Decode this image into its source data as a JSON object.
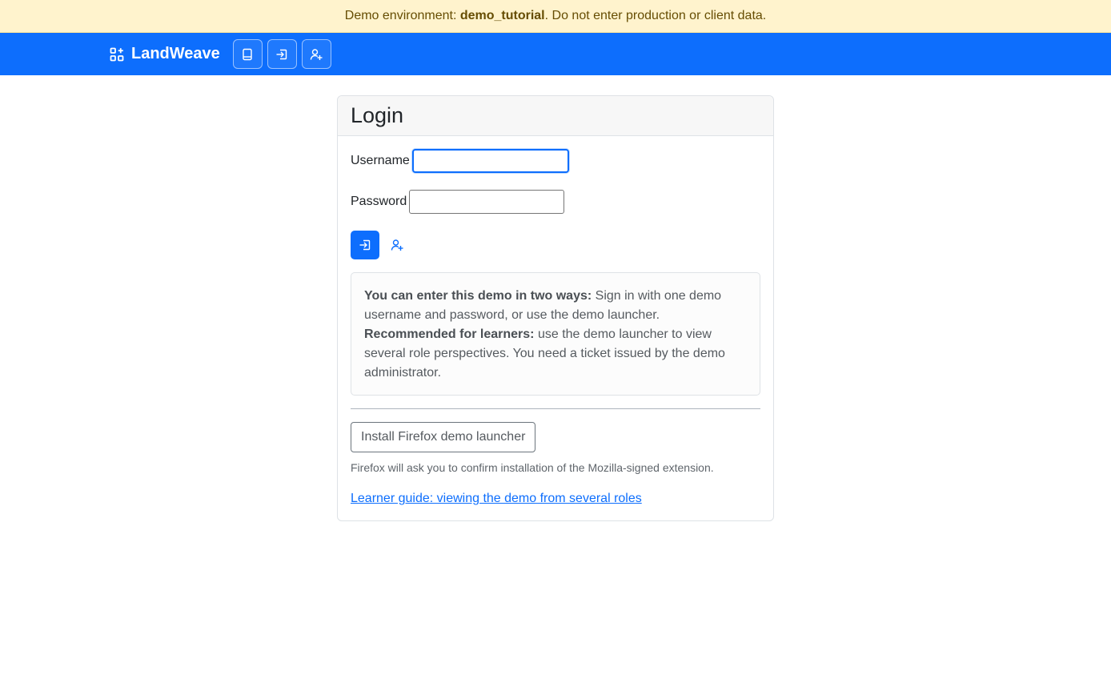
{
  "banner": {
    "prefix": "Demo environment: ",
    "env_name": "demo_tutorial",
    "suffix": ". Do not enter production or client data."
  },
  "navbar": {
    "brand": "LandWeave",
    "brand_icon": "grid-plus-icon",
    "icons": [
      "book-icon",
      "login-icon",
      "person-plus-icon"
    ],
    "color": "#0d6efd"
  },
  "login": {
    "title": "Login",
    "username_label": "Username",
    "username_value": "",
    "password_label": "Password",
    "password_value": "",
    "submit_icon": "login-icon",
    "register_icon": "person-plus-icon"
  },
  "info": {
    "line1_bold": "You can enter this demo in two ways:",
    "line1_text": " Sign in with one demo username and password, or use the demo launcher.",
    "line2_bold": "Recommended for learners:",
    "line2_text": " use the demo launcher to view several role perspectives. You need a ticket issued by the demo administrator."
  },
  "install": {
    "button_label": "Install Firefox demo launcher",
    "note": "Firefox will ask you to confirm installation of the Mozilla-signed extension."
  },
  "guide_link": "Learner guide: viewing the demo from several roles"
}
